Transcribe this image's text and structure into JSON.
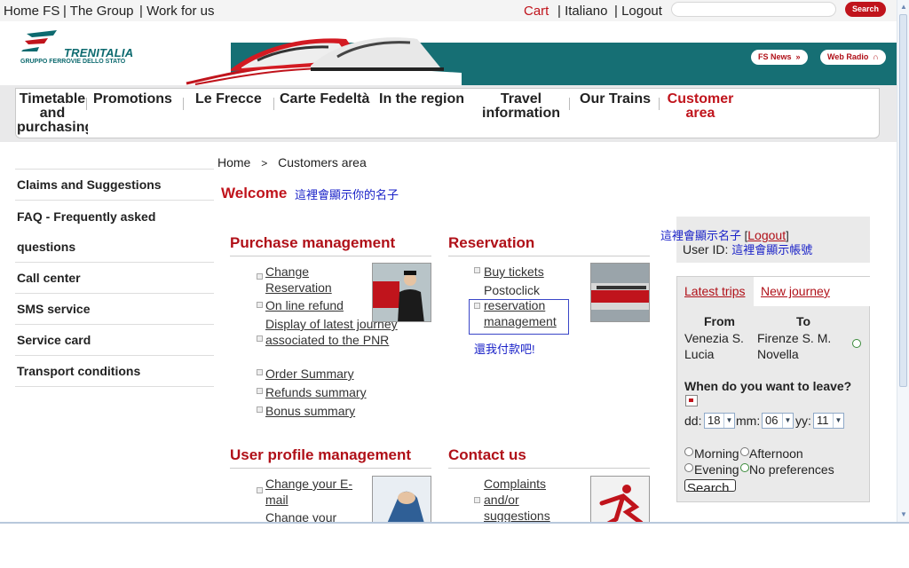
{
  "topbar": {
    "home": "Home FS",
    "group": "| The Group",
    "work": "| Work for us",
    "cart": "Cart",
    "lang": "| Italiano",
    "logout": "| Logout",
    "search_label": "Search"
  },
  "brand": {
    "name": "TRENITALIA",
    "subtitle": "GRUPPO FERROVIE DELLO STATO",
    "fs_news": "FS News",
    "web_radio": "Web Radio"
  },
  "nav": {
    "items": [
      {
        "label": "Timetable and purchasing"
      },
      {
        "label": "Promotions"
      },
      {
        "label": "Le Frecce"
      },
      {
        "label": "Carte Fedeltà"
      },
      {
        "label": "In the region"
      },
      {
        "label": "Travel information"
      },
      {
        "label": "Our Trains"
      },
      {
        "label": "Customer area"
      }
    ]
  },
  "breadcrumb": {
    "home": "Home",
    "sep": ">",
    "current": "Customers area"
  },
  "welcome": {
    "label": "Welcome",
    "name_placeholder": "這裡會顯示你的名子"
  },
  "sidebar": {
    "items": [
      {
        "label": "Claims and Suggestions"
      },
      {
        "label": "FAQ - Frequently asked questions"
      },
      {
        "label": "Call center"
      },
      {
        "label": "SMS service"
      },
      {
        "label": "Service card"
      },
      {
        "label": "Transport conditions"
      }
    ]
  },
  "sections": {
    "purchase": {
      "title": "Purchase management",
      "links": [
        "Change Reservation",
        "On line refund",
        "Display of latest journey associated to the PNR",
        "Order Summary",
        "Refunds summary",
        "Bonus summary"
      ]
    },
    "reservation": {
      "title": "Reservation",
      "links": [
        "Buy tickets",
        "Postoclick",
        "reservation management"
      ],
      "note": "還我付款吧!"
    },
    "profile": {
      "title": "User profile management",
      "links": [
        "Change your E-mail",
        "Change your"
      ]
    },
    "contact": {
      "title": "Contact us",
      "links": [
        "Complaints and/or suggestions"
      ]
    }
  },
  "account": {
    "name_placeholder": "這裡會顯示名子",
    "logout": "Logout",
    "bracket_open": "[",
    "bracket_close": "]",
    "userid_label": "User ID:",
    "userid_value": "這裡會顯示帳號"
  },
  "journey": {
    "tab_latest": "Latest trips",
    "tab_new": "New journey",
    "from_label": "From",
    "to_label": "To",
    "from_value": "Venezia S. Lucia",
    "to_value": "Firenze S. M. Novella",
    "question": "When do you want to leave?",
    "dd_label": "dd:",
    "dd_value": "18",
    "mm_label": "mm:",
    "mm_value": "06",
    "yy_label": "yy:",
    "yy_value": "11",
    "opt_morning": "Morning",
    "opt_afternoon": "Afternoon",
    "opt_evening": "Evening",
    "opt_nopref": "No preferences",
    "search_btn": "Search"
  },
  "colors": {
    "brand_red": "#c0141c",
    "brand_teal": "#166f74",
    "link_blue": "#1a22c8"
  }
}
